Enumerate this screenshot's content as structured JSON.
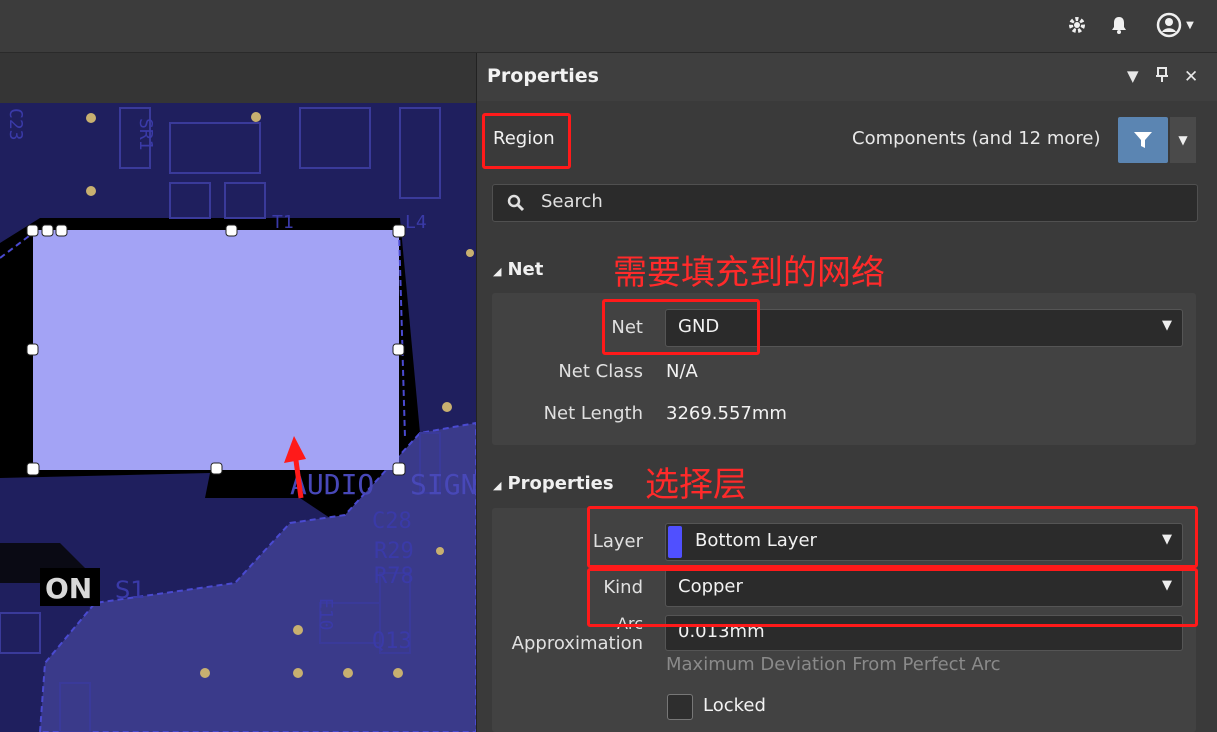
{
  "panel": {
    "title": "Properties",
    "object_type": "Region",
    "filter_label": "Components (and 12 more)",
    "search_placeholder": "Search"
  },
  "net_section": {
    "title": "Net",
    "net_label": "Net",
    "net_value": "GND",
    "net_class_label": "Net Class",
    "net_class_value": "N/A",
    "net_length_label": "Net Length",
    "net_length_value": "3269.557mm"
  },
  "properties_section": {
    "title": "Properties",
    "layer_label": "Layer",
    "layer_value": "Bottom Layer",
    "layer_color": "#5050ff",
    "kind_label": "Kind",
    "kind_value": "Copper",
    "arc_label_line1": "Arc",
    "arc_label_line2": "Approximation",
    "arc_value": "0.013mm",
    "arc_hint": "Maximum Deviation From Perfect Arc",
    "locked_label": "Locked"
  },
  "annotations": {
    "net_note": "需要填充到的网络",
    "layer_note": "选择层"
  },
  "pcb_text": {
    "audio": "AUDIO",
    "sign": "SIGN",
    "on": "ON",
    "s1": "S1",
    "q13": "Q13",
    "c28": "C28",
    "r29": "R29",
    "r78": "R78",
    "sr1": "SR1",
    "e10": "E10",
    "c23": "C23",
    "t1": "T1",
    "l4": "L4"
  },
  "colors": {
    "accent_filter": "#5b85b2",
    "annotation": "#ff1a1a",
    "board": "#1f1f5e",
    "region_fill": "#a3a3f5"
  }
}
